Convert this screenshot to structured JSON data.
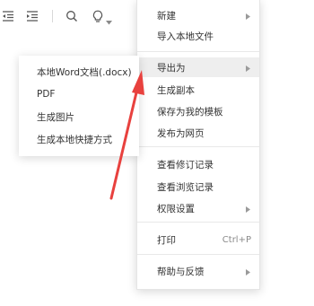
{
  "toolbar": {
    "icons": [
      "outdent-icon",
      "indent-icon",
      "search-icon",
      "lightbulb-icon",
      "chevron-down-icon"
    ]
  },
  "menu": {
    "items": [
      {
        "label": "新建",
        "has_submenu": true
      },
      {
        "label": "导入本地文件",
        "has_submenu": false
      },
      {
        "label": "导出为",
        "has_submenu": true,
        "active": true
      },
      {
        "label": "生成副本",
        "has_submenu": false
      },
      {
        "label": "保存为我的模板",
        "has_submenu": false
      },
      {
        "label": "发布为网页",
        "has_submenu": false
      },
      {
        "label": "查看修订记录",
        "has_submenu": false
      },
      {
        "label": "查看浏览记录",
        "has_submenu": false
      },
      {
        "label": "权限设置",
        "has_submenu": true
      },
      {
        "label": "打印",
        "shortcut": "Ctrl+P"
      },
      {
        "label": "帮助与反馈",
        "has_submenu": true
      }
    ]
  },
  "export_submenu": {
    "items": [
      {
        "label": "本地Word文档(.docx)"
      },
      {
        "label": "PDF"
      },
      {
        "label": "生成图片"
      },
      {
        "label": "生成本地快捷方式"
      }
    ]
  },
  "colors": {
    "annotation_arrow": "#e8413e",
    "active_item_bg": "#eeeeee",
    "text": "#333333",
    "icon": "#555555"
  }
}
